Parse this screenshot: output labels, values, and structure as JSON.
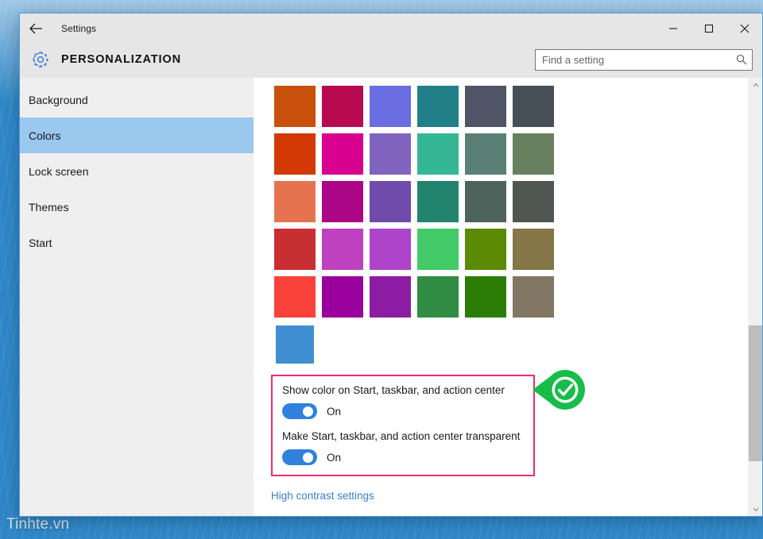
{
  "window": {
    "titlebar_title": "Settings",
    "back_icon": "back-arrow-icon",
    "minimize_label": "–",
    "maximize_label": "❑",
    "close_label": "✕"
  },
  "header": {
    "gear_icon": "gear-icon",
    "page_title": "PERSONALIZATION"
  },
  "search": {
    "placeholder": "Find a setting",
    "value": "",
    "icon": "search-icon"
  },
  "sidebar": {
    "items": [
      {
        "label": "Background",
        "selected": false
      },
      {
        "label": "Colors",
        "selected": true
      },
      {
        "label": "Lock screen",
        "selected": false
      },
      {
        "label": "Themes",
        "selected": false
      },
      {
        "label": "Start",
        "selected": false
      }
    ]
  },
  "colors_page": {
    "accent_swatches": [
      [
        "#c9500a",
        "#b80a50",
        "#6b6ee0",
        "#217f87",
        "#4f5566",
        "#454f55"
      ],
      [
        "#d23905",
        "#d8008f",
        "#8064bf",
        "#35b694",
        "#5a7f75",
        "#67805f"
      ],
      [
        "#e5734f",
        "#ab0686",
        "#6f4bac",
        "#22836f",
        "#4e635c",
        "#4f5750"
      ],
      [
        "#c72f33",
        "#be42bf",
        "#ae44ca",
        "#42cb68",
        "#5b8a04",
        "#847647"
      ],
      [
        "#f9423a",
        "#99009c",
        "#8b1ca3",
        "#2f8c42",
        "#2c7d05",
        "#827665"
      ],
      [
        "#3f8fd2"
      ]
    ],
    "selected_swatch": {
      "row": 5,
      "col": 0,
      "color": "#3f8fd2"
    },
    "options": [
      {
        "label": "Show color on Start, taskbar, and action center",
        "toggle_state": "On",
        "toggle_on": true
      },
      {
        "label": "Make Start, taskbar, and action center transparent",
        "toggle_state": "On",
        "toggle_on": true
      }
    ],
    "high_contrast_link": "High contrast settings",
    "annotation_icon": "green-check-arrow-icon",
    "highlight_box_color": "#ef2b6e",
    "toggle_color": "#2f81dd",
    "link_color": "#3a7fd5"
  },
  "desktop": {
    "watermark": "Tinhte.vn"
  }
}
